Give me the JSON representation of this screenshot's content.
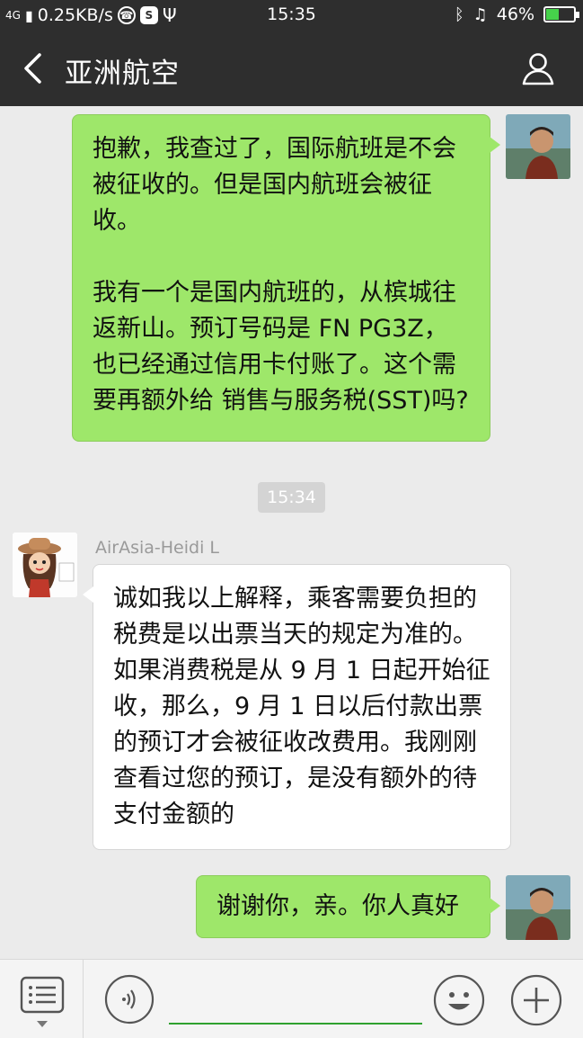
{
  "status_bar": {
    "network": "4G",
    "speed": "0.25KB/s",
    "time": "15:35",
    "battery": "46%",
    "battery_level": 0.46,
    "battery_color": "#46d24b"
  },
  "header": {
    "title": "亚洲航空"
  },
  "messages": [
    {
      "direction": "outgoing",
      "text": "抱歉，我查过了，国际航班是不会\n被征收的。但是国内航班会被征\n收。\n\n我有一个是国内航班的，从槟城往\n返新山。预订号码是 FN PG3Z，\n也已经通过信用卡付账了。这个需\n要再额外给 销售与服务税(SST)吗?"
    },
    {
      "type": "timestamp",
      "text": "15:34"
    },
    {
      "direction": "incoming",
      "sender": "AirAsia-Heidi L",
      "text": "诚如我以上解释，乘客需要负担的\n税费是以出票当天的规定为准的。\n如果消费税是从 9 月 1 日起开始征\n收，那么，9 月 1 日以后付款出票\n的预订才会被征收改费用。我刚刚\n查看过您的预订，是没有额外的待\n支付金额的"
    },
    {
      "direction": "outgoing",
      "text": "谢谢你，亲。你人真好"
    }
  ],
  "colors": {
    "outgoing_bubble": "#9ee76a",
    "incoming_bubble": "#ffffff",
    "header_bg": "#2e2e2e",
    "chat_bg": "#ebebeb",
    "input_underline": "#2fa12f"
  },
  "icons": {
    "back": "chevron-left-icon",
    "profile": "person-icon",
    "menu": "list-menu-icon",
    "voice": "voice-wave-icon",
    "emoji": "smiley-icon",
    "more": "plus-icon"
  }
}
